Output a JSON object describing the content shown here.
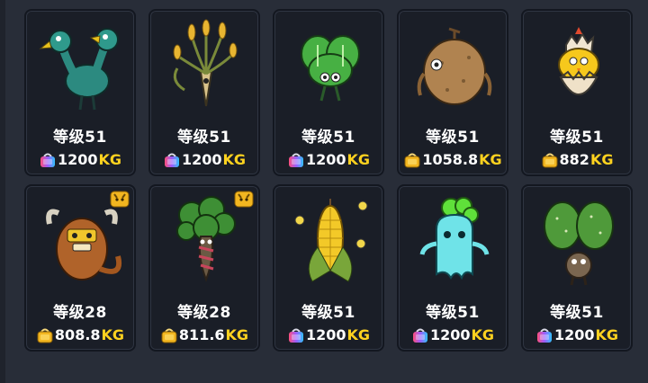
{
  "cards": [
    {
      "level": "等级51",
      "value": "1200",
      "unit": "KG",
      "bag": "rainbow-bag-icon",
      "badge": false,
      "creature": "two-headed-bird-icon"
    },
    {
      "level": "等级51",
      "value": "1200",
      "unit": "KG",
      "bag": "rainbow-bag-icon",
      "badge": false,
      "creature": "wheat-creature-icon"
    },
    {
      "level": "等级51",
      "value": "1200",
      "unit": "KG",
      "bag": "rainbow-bag-icon",
      "badge": false,
      "creature": "lettuce-creature-icon"
    },
    {
      "level": "等级51",
      "value": "1058.8",
      "unit": "KG",
      "bag": "gold-bag-icon",
      "badge": false,
      "creature": "potato-creature-icon"
    },
    {
      "level": "等级51",
      "value": "882",
      "unit": "KG",
      "bag": "gold-bag-icon",
      "badge": false,
      "creature": "hatching-chick-icon"
    },
    {
      "level": "等级28",
      "value": "808.8",
      "unit": "KG",
      "bag": "gold-bag-icon",
      "badge": true,
      "creature": "yak-creature-icon"
    },
    {
      "level": "等级28",
      "value": "811.6",
      "unit": "KG",
      "bag": "gold-bag-icon",
      "badge": true,
      "creature": "broccoli-tree-icon"
    },
    {
      "level": "等级51",
      "value": "1200",
      "unit": "KG",
      "bag": "rainbow-bag-icon",
      "badge": false,
      "creature": "corn-creature-icon"
    },
    {
      "level": "等级51",
      "value": "1200",
      "unit": "KG",
      "bag": "rainbow-bag-icon",
      "badge": false,
      "creature": "ghost-creature-icon"
    },
    {
      "level": "等级51",
      "value": "1200",
      "unit": "KG",
      "bag": "rainbow-bag-icon",
      "badge": false,
      "creature": "cactus-creature-icon"
    }
  ],
  "colors": {
    "card_bg": "#1a1e27",
    "page_bg": "#282d38",
    "unit": "#ffd21f",
    "gold": "#f2b620"
  }
}
